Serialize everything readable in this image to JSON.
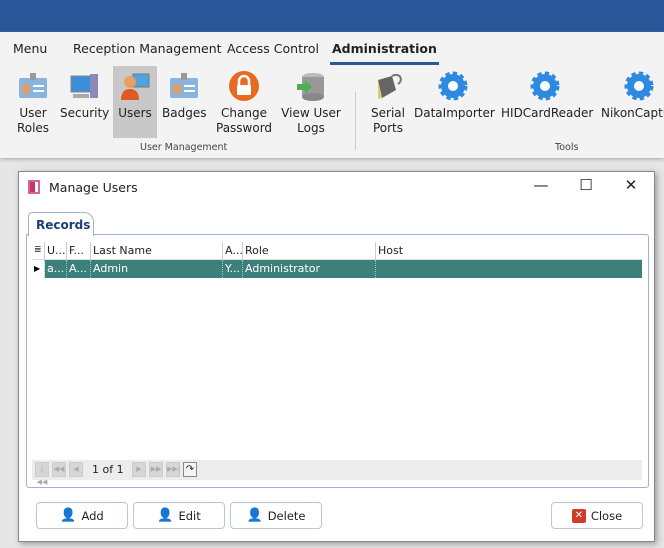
{
  "ribbon": {
    "tabs": [
      "Menu",
      "Reception Management",
      "Access Control",
      "Administration"
    ],
    "active_tab": "Administration",
    "buttons": [
      {
        "label": "User Roles",
        "icon": "id-card-icon"
      },
      {
        "label": "Security",
        "icon": "computer-security-icon"
      },
      {
        "label": "Users",
        "icon": "users-icon"
      },
      {
        "label": "Badges",
        "icon": "badge-icon"
      },
      {
        "label": "Change Password",
        "icon": "lock-icon"
      },
      {
        "label": "View User Logs",
        "icon": "database-icon"
      },
      {
        "label": "Serial Ports",
        "icon": "serial-port-icon"
      },
      {
        "label": "DataImporter",
        "icon": "gear-icon"
      },
      {
        "label": "HIDCardReader",
        "icon": "gear-icon"
      },
      {
        "label": "NikonCaptu",
        "icon": "gear-icon"
      }
    ],
    "groups": [
      "User Management",
      "Tools"
    ]
  },
  "window": {
    "title": "Manage Users",
    "tab": "Records",
    "columns": [
      "U...",
      "F...",
      "Last Name",
      "A...",
      "Role",
      "Host"
    ],
    "rows": [
      [
        "a...",
        "A...",
        "Admin",
        "Y...",
        "Administrator",
        ""
      ]
    ],
    "pager": "1 of 1",
    "buttons": {
      "add": "Add",
      "edit": "Edit",
      "delete": "Delete",
      "close": "Close"
    },
    "row_color": "#3d8079"
  }
}
